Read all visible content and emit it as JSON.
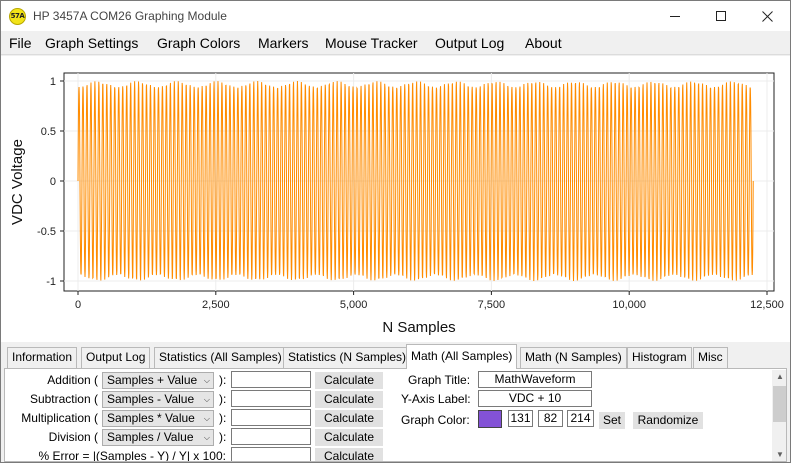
{
  "window": {
    "title": "HP 3457A COM26 Graphing Module",
    "icon_text": "57A",
    "controls": [
      "minimize",
      "maximize",
      "close"
    ]
  },
  "menu": [
    "File",
    "Graph Settings",
    "Graph Colors",
    "Markers",
    "Mouse Tracker",
    "Output Log",
    "About"
  ],
  "chart_data": {
    "type": "line",
    "title": "",
    "xlabel": "N Samples",
    "ylabel": "VDC Voltage",
    "xlim": [
      0,
      12500
    ],
    "ylim": [
      -1,
      1
    ],
    "x_ticks": [
      "0",
      "2,500",
      "5,000",
      "7,500",
      "10,000",
      "12,500"
    ],
    "y_ticks": [
      "1",
      "0.5",
      "0",
      "-0.5",
      "-1"
    ],
    "grid": true,
    "legend": "none",
    "series": [
      {
        "color": "#ff8c00",
        "description_x_range": [
          0,
          12250
        ],
        "waveform": "dense oscillation between -1 and 1 (high-frequency sine, ~170 visible cycles)"
      }
    ]
  },
  "tabs": [
    {
      "label": "Information",
      "active": false
    },
    {
      "label": "Output Log",
      "active": false
    },
    {
      "label": "Statistics (All Samples)",
      "active": false
    },
    {
      "label": "Statistics (N Samples)",
      "active": false
    },
    {
      "label": "Math (All Samples)",
      "active": true
    },
    {
      "label": "Math (N Samples)",
      "active": false
    },
    {
      "label": "Histogram",
      "active": false
    },
    {
      "label": "Misc",
      "active": false
    }
  ],
  "math": {
    "rows": [
      {
        "label": "Addition (",
        "op": "Samples + Value",
        "close": "):",
        "value": "",
        "button": "Calculate"
      },
      {
        "label": "Subtraction (",
        "op": "Samples - Value",
        "close": "):",
        "value": "",
        "button": "Calculate"
      },
      {
        "label": "Multiplication (",
        "op": "Samples * Value",
        "close": "):",
        "value": "",
        "button": "Calculate"
      },
      {
        "label": "Division (",
        "op": "Samples / Value",
        "close": "):",
        "value": "",
        "button": "Calculate"
      },
      {
        "label": "% Error = |(Samples - Y) / Y| x 100:",
        "value": "",
        "button": "Calculate"
      }
    ],
    "graph_title_label": "Graph Title:",
    "graph_title_value": "MathWaveform",
    "y_axis_label_label": "Y-Axis Label:",
    "y_axis_label_value": "VDC + 10",
    "graph_color_label": "Graph Color:",
    "graph_color": "#8352d6",
    "color_r": "131",
    "color_g": "82",
    "color_b": "214",
    "set_button": "Set",
    "randomize_button": "Randomize"
  }
}
